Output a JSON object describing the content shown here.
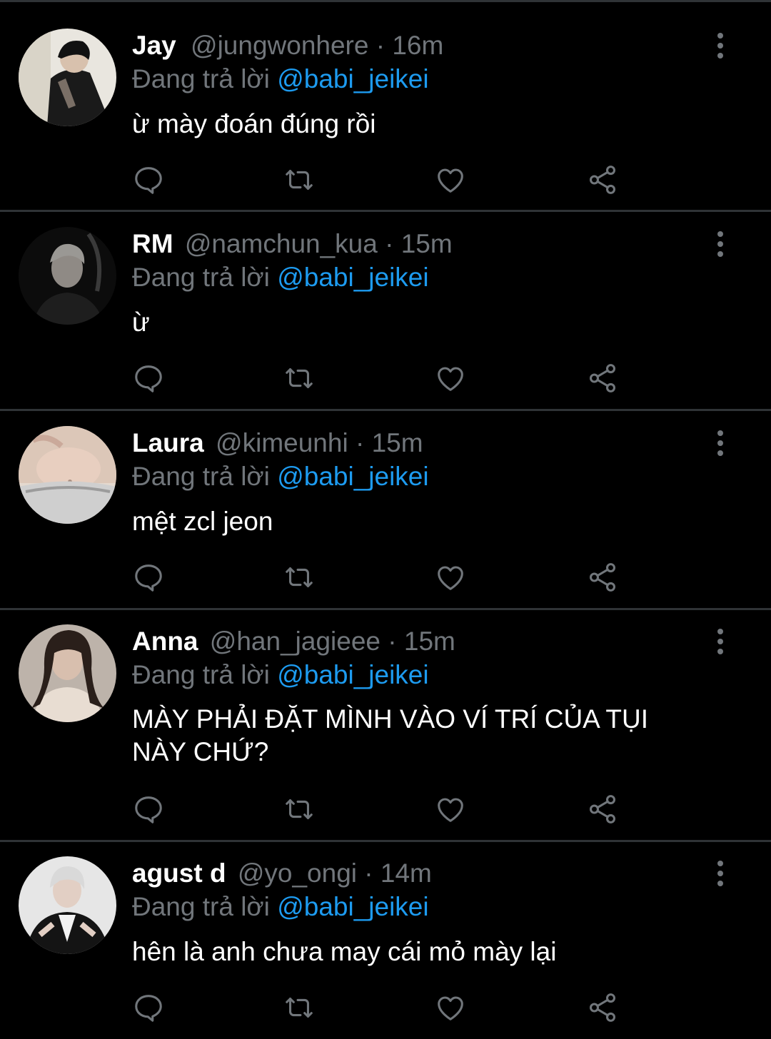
{
  "tweets": [
    {
      "display_name": "Jay",
      "handle": "@jungwonhere",
      "separator": "·",
      "time": "16m",
      "reply_prefix": "Đang trả lời",
      "reply_to": "@babi_jeikei",
      "text": "ừ mày đoán đúng rồi"
    },
    {
      "display_name": "RM",
      "handle": "@namchun_kua",
      "separator": "·",
      "time": "15m",
      "reply_prefix": "Đang trả lời",
      "reply_to": "@babi_jeikei",
      "text": "ừ"
    },
    {
      "display_name": "Laura",
      "handle": "@kimeunhi",
      "separator": "·",
      "time": "15m",
      "reply_prefix": "Đang trả lời",
      "reply_to": "@babi_jeikei",
      "text": "mệt zcl jeon"
    },
    {
      "display_name": "Anna",
      "handle": "@han_jagieee",
      "separator": "·",
      "time": "15m",
      "reply_prefix": "Đang trả lời",
      "reply_to": "@babi_jeikei",
      "text": "MÀY PHẢI ĐẶT MÌNH VÀO VÍ TRÍ CỦA TỤI NÀY CHỨ?"
    },
    {
      "display_name": "agust d",
      "handle": "@yo_ongi",
      "separator": "·",
      "time": "14m",
      "reply_prefix": "Đang trả lời",
      "reply_to": "@babi_jeikei",
      "text": "hên là anh chưa may cái mỏ mày lại"
    }
  ],
  "icons": {
    "reply": "reply-bubble-icon",
    "retweet": "retweet-icon",
    "like": "heart-icon",
    "share": "share-icon",
    "more": "more-vertical-icon"
  },
  "colors": {
    "background": "#000000",
    "text": "#ffffff",
    "muted": "#71767b",
    "mention": "#1d9bf0",
    "divider": "#2f3336"
  }
}
